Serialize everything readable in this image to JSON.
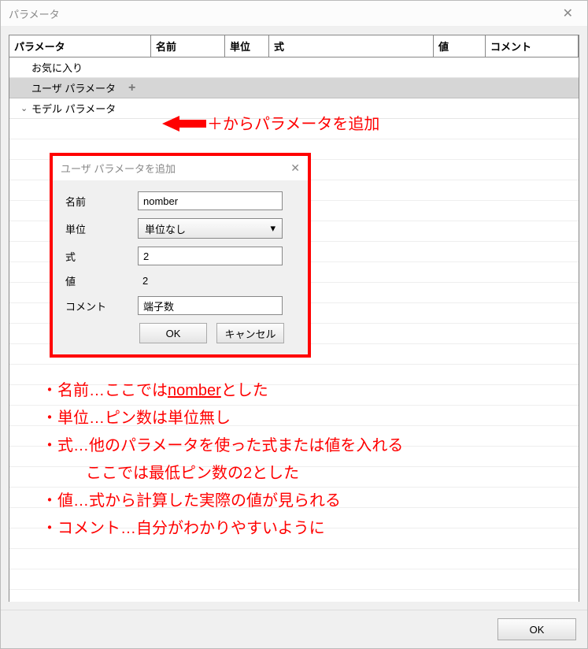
{
  "window": {
    "title": "パラメータ"
  },
  "grid": {
    "headers": [
      "パラメータ",
      "名前",
      "単位",
      "式",
      "値",
      "コメント"
    ]
  },
  "tree": {
    "favorites": "お気に入り",
    "user_params": "ユーザ パラメータ",
    "model_params": "モデル パラメータ",
    "add_glyph": "+"
  },
  "annotation": {
    "arrow_text": "＋からパラメータを追加"
  },
  "dialog": {
    "title": "ユーザ パラメータを追加",
    "labels": {
      "name": "名前",
      "unit": "単位",
      "expr": "式",
      "value": "値",
      "comment": "コメント"
    },
    "values": {
      "name": "nomber",
      "unit": "単位なし",
      "expr": "2",
      "value": "2",
      "comment": "端子数"
    },
    "buttons": {
      "ok": "OK",
      "cancel": "キャンセル"
    }
  },
  "notes": {
    "l1a": "・名前…ここでは",
    "l1b": "nomber",
    "l1c": "とした",
    "l2": "・単位…ピン数は単位無し",
    "l3": "・式…他のパラメータを使った式または値を入れる",
    "l3b": "ここでは最低ピン数の2とした",
    "l4": "・値…式から計算した実際の値が見られる",
    "l5": "・コメント…自分がわかりやすいように"
  },
  "footer": {
    "ok": "OK"
  }
}
